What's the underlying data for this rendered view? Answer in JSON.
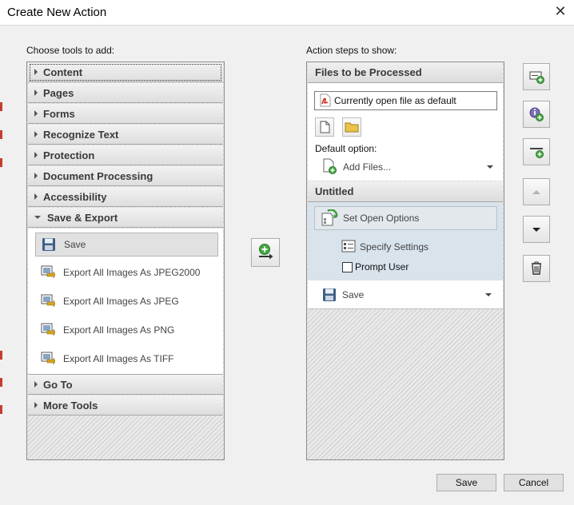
{
  "window": {
    "title": "Create New Action"
  },
  "left_panel": {
    "label": "Choose tools to add:",
    "categories_top": [
      "Content",
      "Pages",
      "Forms",
      "Recognize Text",
      "Protection",
      "Document Processing",
      "Accessibility"
    ],
    "expanded_category": "Save & Export",
    "tools": [
      "Save",
      "Export All Images As JPEG2000",
      "Export All Images As JPEG",
      "Export All Images As PNG",
      "Export All Images As TIFF"
    ],
    "categories_bottom": [
      "Go To",
      "More Tools"
    ]
  },
  "right_panel": {
    "label": "Action steps to show:",
    "files_header": "Files to be Processed",
    "file_field": "Currently open file as default",
    "default_option_label": "Default option:",
    "add_files": "Add Files...",
    "untitled_header": "Untitled",
    "set_open_options": "Set Open Options",
    "specify_settings": "Specify Settings",
    "prompt_user": "Prompt User",
    "save_step": "Save"
  },
  "buttons": {
    "save": "Save",
    "cancel": "Cancel"
  },
  "colors": {
    "accent_red": "#d0281c",
    "accent_green": "#3b9b3b",
    "step_highlight": "#d8e3ec"
  }
}
